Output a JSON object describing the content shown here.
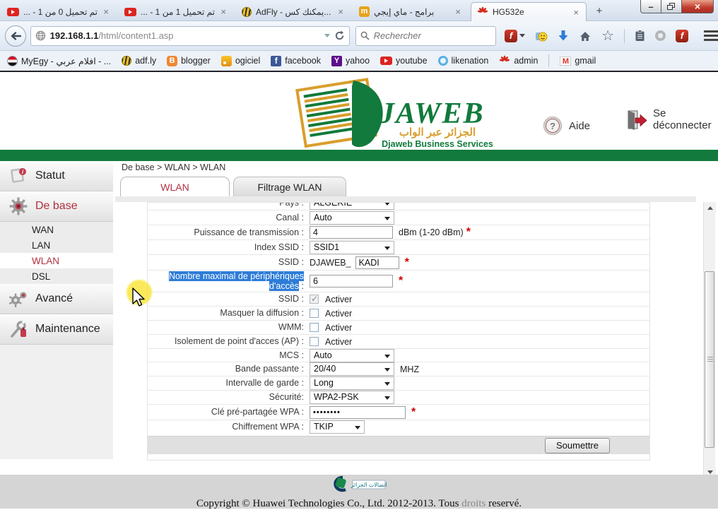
{
  "glyphs": {
    "close": "×",
    "plus": "+",
    "minimize": "–",
    "search_hint": "Rechercher"
  },
  "browser": {
    "tabs": [
      {
        "title": "تم تحميل 0 من 1 - ...",
        "favicon": "youtube-icon"
      },
      {
        "title": "تم تحميل 1 من 1 - ...",
        "favicon": "youtube-icon"
      },
      {
        "title": "AdFly - يمكنك كس...",
        "favicon": "bee-icon"
      },
      {
        "title": "برامج - ماي إيجي",
        "favicon": "myegy-icon",
        "favletter": "m"
      },
      {
        "title": "HG532e",
        "favicon": "huawei-icon",
        "active": true
      }
    ],
    "url": {
      "host": "192.168.1.1",
      "path": "/html/content1.asp"
    },
    "search_placeholder": "Rechercher",
    "bookmarks": [
      {
        "label": "MyEgy - افلام عربي - ...",
        "icon": "egypt-flag-icon"
      },
      {
        "label": "adf.ly",
        "icon": "bee-icon"
      },
      {
        "label": "blogger",
        "icon": "blogger-icon",
        "favletter": "B"
      },
      {
        "label": "ogiciel",
        "icon": "rss-icon"
      },
      {
        "label": "facebook",
        "icon": "facebook-icon",
        "favletter": "f"
      },
      {
        "label": "yahoo",
        "icon": "yahoo-icon",
        "favletter": "Y"
      },
      {
        "label": "youtube",
        "icon": "youtube-icon"
      },
      {
        "label": "likenation",
        "icon": "likenation-icon"
      },
      {
        "label": "admin",
        "icon": "huawei-icon"
      },
      {
        "label": "gmail",
        "icon": "gmail-icon",
        "favletter": "M"
      }
    ]
  },
  "site": {
    "logo": {
      "name": "JAWEB",
      "arabic": "الجزائر عبر الواب",
      "tagline": "Djaweb Business Services"
    },
    "help_label": "Aide",
    "logout_label": "Se déconnecter",
    "colors": {
      "green": "#117a3c",
      "gold": "#d99e2b",
      "active_red": "#b03040"
    }
  },
  "sidebar": {
    "items": [
      {
        "label": "Statut"
      },
      {
        "label": "De base",
        "active": true
      },
      {
        "label": "WAN"
      },
      {
        "label": "LAN"
      },
      {
        "label": "WLAN",
        "active": true
      },
      {
        "label": "DSL"
      },
      {
        "label": "Avancé"
      },
      {
        "label": "Maintenance"
      }
    ]
  },
  "main": {
    "breadcrumb": "De base > WLAN > WLAN",
    "tabs": [
      {
        "label": "WLAN",
        "active": true
      },
      {
        "label": "Filtrage WLAN",
        "active": false
      }
    ],
    "form": {
      "required_marker": "*",
      "rows": [
        {
          "label": "Pays :",
          "control": "select",
          "value": "ALGERIE"
        },
        {
          "label": "Canal :",
          "control": "select",
          "value": "Auto"
        },
        {
          "label": "Puissance de transmission :",
          "control": "text",
          "value": "4",
          "suffix": "dBm (1-20 dBm)",
          "required": true
        },
        {
          "label": "Index SSID :",
          "control": "select",
          "value": "SSID1"
        },
        {
          "label": "SSID :",
          "control": "text",
          "prefix": "DJAWEB_",
          "value": "KADI",
          "required": true
        },
        {
          "label": "Nombre maximal de périphériques d'accès",
          "label_suffix": " :",
          "selected": true,
          "control": "text",
          "value": "6",
          "required": true
        },
        {
          "label": "SSID :",
          "control": "checkbox",
          "checked": true,
          "disabled": true,
          "value": "Activer"
        },
        {
          "label": "Masquer la diffusion :",
          "control": "checkbox",
          "checked": false,
          "value": "Activer"
        },
        {
          "label": "WMM:",
          "control": "checkbox",
          "checked": false,
          "value": "Activer"
        },
        {
          "label": "Isolement de point d'acces (AP) :",
          "control": "checkbox",
          "checked": false,
          "value": "Activer"
        },
        {
          "label": "MCS :",
          "control": "select",
          "value": "Auto"
        },
        {
          "label": "Bande passante :",
          "control": "select",
          "value": "20/40",
          "suffix": "MHZ"
        },
        {
          "label": "Intervalle de garde :",
          "control": "select",
          "value": "Long"
        },
        {
          "label": "Sécurité:",
          "control": "select",
          "value": "WPA2-PSK"
        },
        {
          "label": "Clé pré-partagée WPA :",
          "control": "password",
          "value": "••••••••",
          "required": true
        },
        {
          "label": "Chiffrement WPA :",
          "control": "select",
          "value": "TKIP"
        }
      ],
      "submit_label": "Soumettre"
    }
  },
  "footer": {
    "logo_arabic": "اتصالات الجزائر",
    "copyright_prefix": "Copyright © Huawei Technologies Co., Ltd. 2012-2013. Tous ",
    "copyright_muted": "droits",
    "copyright_suffix": " reservé."
  }
}
